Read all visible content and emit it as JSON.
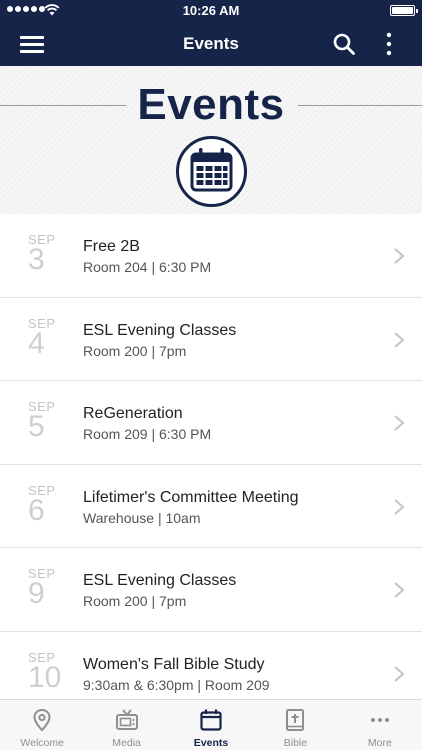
{
  "status_bar": {
    "time": "10:26 AM"
  },
  "nav": {
    "title": "Events",
    "menu_icon": "hamburger-icon",
    "search_icon": "search-icon",
    "more_icon": "vertical-ellipsis-icon"
  },
  "header": {
    "title": "Events",
    "icon": "calendar-icon"
  },
  "colors": {
    "primary": "#16244a",
    "tab_inactive": "#8e8e93",
    "date_gray": "#cfcfd3"
  },
  "events": [
    {
      "month": "SEP",
      "day": "3",
      "title": "Free 2B",
      "details": "Room 204 | 6:30 PM"
    },
    {
      "month": "SEP",
      "day": "4",
      "title": "ESL Evening Classes",
      "details": "Room 200 | 7pm"
    },
    {
      "month": "SEP",
      "day": "5",
      "title": "ReGeneration",
      "details": "Room 209 | 6:30 PM"
    },
    {
      "month": "SEP",
      "day": "6",
      "title": "Lifetimer's Committee Meeting",
      "details": "Warehouse | 10am"
    },
    {
      "month": "SEP",
      "day": "9",
      "title": "ESL Evening Classes",
      "details": "Room 200 | 7pm"
    },
    {
      "month": "SEP",
      "day": "10",
      "title": "Women's Fall Bible Study",
      "details": "9:30am & 6:30pm | Room 209"
    }
  ],
  "tabs": [
    {
      "label": "Welcome",
      "icon": "location-pin-icon",
      "active": false
    },
    {
      "label": "Media",
      "icon": "tv-icon",
      "active": false
    },
    {
      "label": "Events",
      "icon": "calendar-icon",
      "active": true
    },
    {
      "label": "Bible",
      "icon": "bible-icon",
      "active": false
    },
    {
      "label": "More",
      "icon": "more-dots-icon",
      "active": false
    }
  ]
}
